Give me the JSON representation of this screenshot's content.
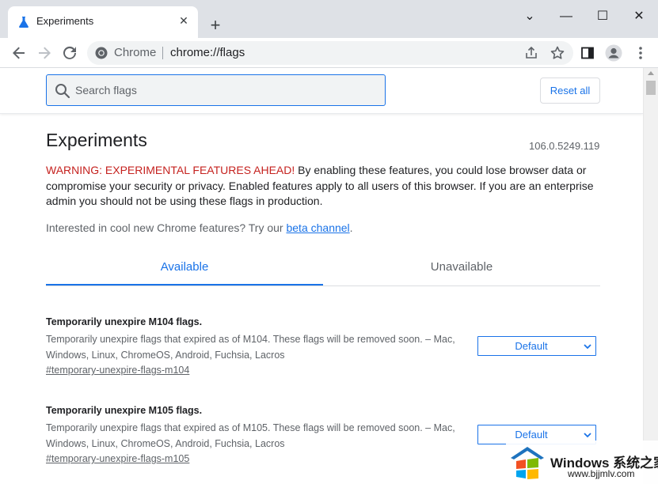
{
  "window": {
    "tab_title": "Experiments",
    "tab_close_glyph": "✕",
    "new_tab_glyph": "+",
    "controls": {
      "tab_search": "⌄",
      "minimize": "—",
      "maximize": "☐",
      "close": "✕"
    }
  },
  "toolbar": {
    "site_name": "Chrome",
    "url": "chrome://flags"
  },
  "header": {
    "search_placeholder": "Search flags",
    "reset_label": "Reset all"
  },
  "main": {
    "title": "Experiments",
    "version": "106.0.5249.119",
    "warning_label": "WARNING: EXPERIMENTAL FEATURES AHEAD!",
    "warning_text": " By enabling these features, you could lose browser data or compromise your security or privacy. Enabled features apply to all users of this browser. If you are an enterprise admin you should not be using these flags in production.",
    "beta_prefix": "Interested in cool new Chrome features? Try our ",
    "beta_link": "beta channel",
    "beta_suffix": ".",
    "tabs": [
      {
        "label": "Available",
        "selected": true
      },
      {
        "label": "Unavailable",
        "selected": false
      }
    ]
  },
  "flags": [
    {
      "name": "Temporarily unexpire M104 flags.",
      "description": "Temporarily unexpire flags that expired as of M104. These flags will be removed soon. – Mac, Windows, Linux, ChromeOS, Android, Fuchsia, Lacros",
      "link": "#temporary-unexpire-flags-m104",
      "value": "Default"
    },
    {
      "name": "Temporarily unexpire M105 flags.",
      "description": "Temporarily unexpire flags that expired as of M105. These flags will be removed soon. – Mac, Windows, Linux, ChromeOS, Android, Fuchsia, Lacros",
      "link": "#temporary-unexpire-flags-m105",
      "value": "Default"
    }
  ],
  "watermark": {
    "brand": "Windows 系统之家",
    "url": "www.bjjmlv.com"
  },
  "colors": {
    "accent": "#1a73e8",
    "warning": "#c5221f",
    "tabstrip": "#dee1e6",
    "omnibox": "#f1f3f4"
  }
}
